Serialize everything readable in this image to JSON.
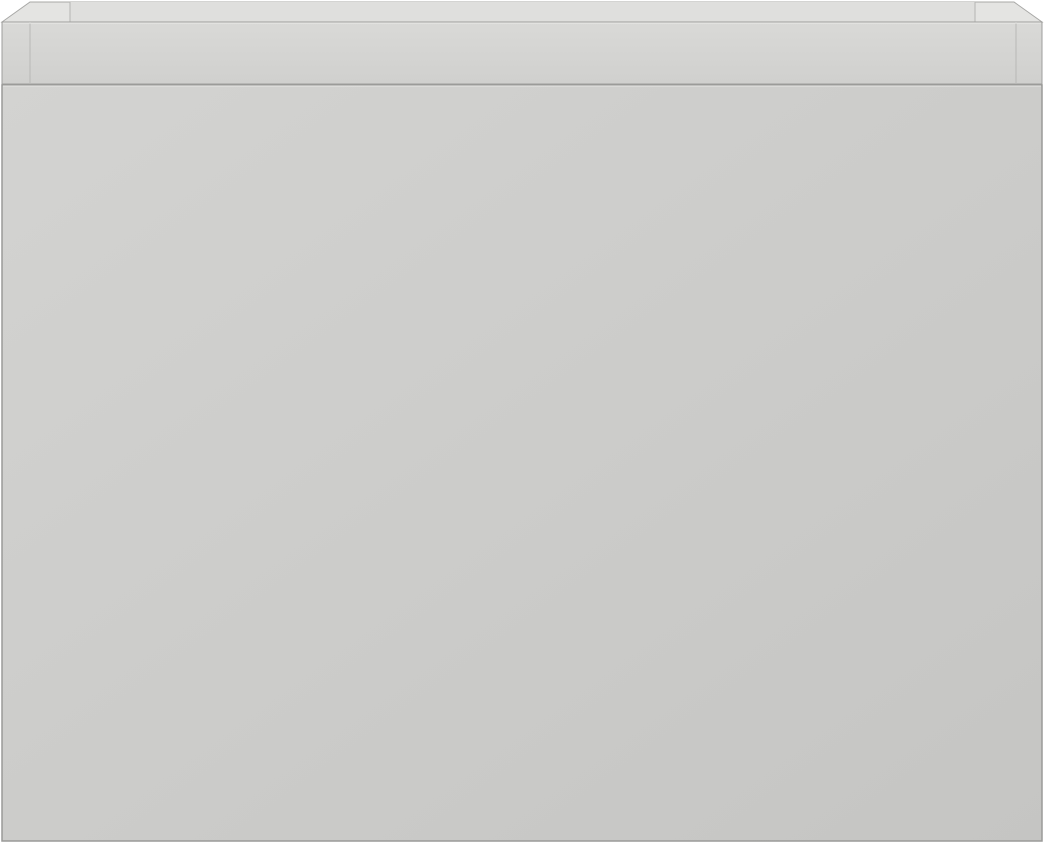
{
  "product": {
    "colors": {
      "front": "#cfcfcd",
      "front_dark": "#c4c4c2",
      "rim": "#d6d6d4",
      "inner_wall": "#dcdcda",
      "edge": "#9a9a98",
      "highlight": "#ececea",
      "background": "#ffffff"
    }
  }
}
